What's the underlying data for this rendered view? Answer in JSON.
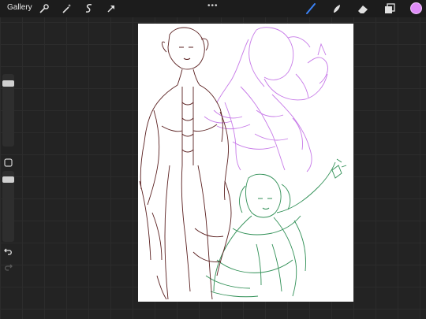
{
  "topbar": {
    "gallery_label": "Gallery",
    "more_label": "•••",
    "left_tools": [
      {
        "name": "wrench-icon"
      },
      {
        "name": "magic-wand-icon"
      },
      {
        "name": "selection-icon"
      },
      {
        "name": "transform-arrow-icon"
      }
    ],
    "right_tools": [
      {
        "name": "brush-icon",
        "active": true
      },
      {
        "name": "smudge-icon"
      },
      {
        "name": "eraser-icon"
      },
      {
        "name": "layers-icon"
      }
    ],
    "current_color": "#df8cf7",
    "active_tool_color": "#3b82f6"
  },
  "sidebar": {
    "brush_size_level": 0.05,
    "opacity_level": 0.05,
    "icons": [
      "modify-square-icon",
      "undo-icon",
      "redo-icon"
    ]
  },
  "canvas": {
    "background": "#ffffff",
    "sketch_colors": {
      "left_figure": "#5a1f1f",
      "top_right_figure": "#c77ae8",
      "bottom_right_figure": "#2f8f55"
    }
  }
}
